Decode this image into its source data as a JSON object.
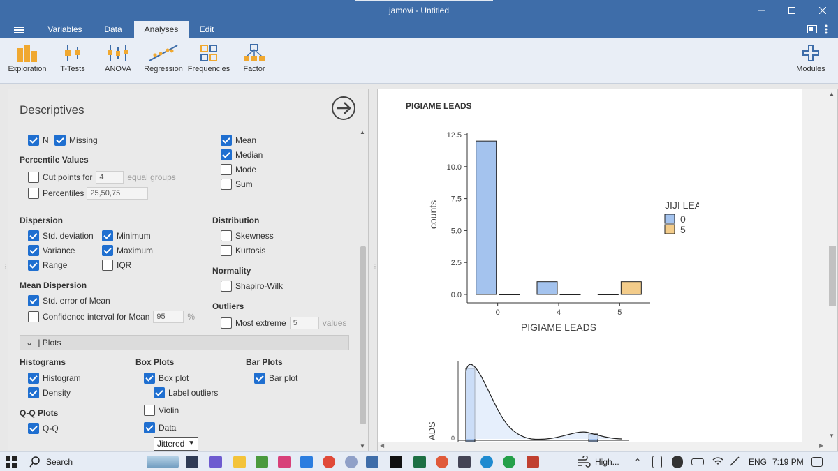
{
  "window": {
    "title": "jamovi - Untitled"
  },
  "menu": {
    "tabs": [
      "Variables",
      "Data",
      "Analyses",
      "Edit"
    ]
  },
  "ribbon": {
    "items": [
      "Exploration",
      "T-Tests",
      "ANOVA",
      "Regression",
      "Frequencies",
      "Factor"
    ],
    "modules": "Modules"
  },
  "descriptives": {
    "title": "Descriptives",
    "stats": {
      "n": "N",
      "missing": "Missing",
      "mean": "Mean",
      "median": "Median",
      "mode": "Mode",
      "sum": "Sum"
    },
    "percentile_values": {
      "heading": "Percentile Values",
      "cut_points_label": "Cut points for",
      "cut_points_value": "4",
      "cut_points_suffix": "equal groups",
      "percentiles_label": "Percentiles",
      "percentiles_value": "25,50,75"
    },
    "dispersion": {
      "heading": "Dispersion",
      "std": "Std. deviation",
      "variance": "Variance",
      "range": "Range",
      "minimum": "Minimum",
      "maximum": "Maximum",
      "iqr": "IQR"
    },
    "distribution": {
      "heading": "Distribution",
      "skewness": "Skewness",
      "kurtosis": "Kurtosis"
    },
    "normality": {
      "heading": "Normality",
      "shapiro": "Shapiro-Wilk"
    },
    "mean_dispersion": {
      "heading": "Mean Dispersion",
      "se": "Std. error of Mean",
      "ci_label": "Confidence interval for Mean",
      "ci_value": "95",
      "ci_unit": "%"
    },
    "outliers": {
      "heading": "Outliers",
      "most_extreme": "Most extreme",
      "value": "5",
      "unit": "values"
    },
    "plots": {
      "bar": "Plots",
      "histograms": {
        "heading": "Histograms",
        "histogram": "Histogram",
        "density": "Density"
      },
      "boxplots": {
        "heading": "Box Plots",
        "box_plot": "Box plot",
        "label_outliers": "Label outliers",
        "violin": "Violin",
        "data": "Data",
        "data_option": "Jittered"
      },
      "barplots": {
        "heading": "Bar Plots",
        "bar_plot": "Bar plot"
      },
      "qq": {
        "heading": "Q-Q Plots",
        "qq": "Q-Q"
      }
    }
  },
  "results": {
    "title": "PIGIAME LEADS",
    "partial_axis_label": "ADS"
  },
  "chart_data": {
    "type": "bar",
    "xlabel": "PIGIAME LEADS",
    "ylabel": "counts",
    "categories": [
      "0",
      "4",
      "5"
    ],
    "ylim": [
      0,
      12.5
    ],
    "yticks": [
      "0.0",
      "2.5",
      "5.0",
      "7.5",
      "10.0",
      "12.5"
    ],
    "legend_title": "JIJI LEADS",
    "legend_position": "right",
    "series": [
      {
        "name": "0",
        "color": "#a4c3ee",
        "values": [
          12,
          1,
          0
        ]
      },
      {
        "name": "5",
        "color": "#f3cc8a",
        "values": [
          0,
          0,
          1
        ]
      }
    ]
  },
  "taskbar": {
    "search": "Search",
    "weather": "High...",
    "lang": "ENG",
    "time": "7:19 PM"
  }
}
